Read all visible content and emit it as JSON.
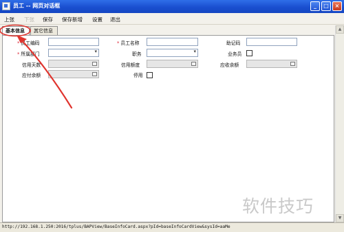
{
  "window": {
    "title": "员工 -- 网页对话框"
  },
  "toolbar": {
    "items": [
      {
        "label": "上张",
        "enabled": true
      },
      {
        "label": "下张",
        "enabled": false
      },
      {
        "label": "保存",
        "enabled": true
      },
      {
        "label": "保存新增",
        "enabled": true
      },
      {
        "label": "设置",
        "enabled": true
      },
      {
        "label": "退出",
        "enabled": true
      }
    ]
  },
  "tabs": [
    {
      "label": "基本信息",
      "active": true
    },
    {
      "label": "其它信息",
      "active": false
    }
  ],
  "form": {
    "employee_code": {
      "label": "员工编码",
      "value": "",
      "required": true
    },
    "employee_name": {
      "label": "员工名称",
      "value": "",
      "required": true
    },
    "mnemonic_code": {
      "label": "助记码",
      "value": ""
    },
    "department": {
      "label": "所属部门",
      "value": "",
      "required": true
    },
    "position": {
      "label": "职务",
      "value": ""
    },
    "salesperson": {
      "label": "业务员",
      "checked": false
    },
    "credit_days": {
      "label": "信用天数",
      "value": ""
    },
    "credit_limit": {
      "label": "信用额度",
      "value": ""
    },
    "receivable_balance": {
      "label": "应收余额",
      "value": ""
    },
    "payable_balance": {
      "label": "应付余额",
      "value": ""
    },
    "disabled": {
      "label": "停用",
      "checked": false
    }
  },
  "status": {
    "url": "http://192.168.1.250:2016/tplus/BAPView/BaseInfoCard.aspx?pId=baseInfoCardView&sysId=aaMe"
  },
  "watermark": "软件技巧",
  "colors": {
    "titlebar": "#1a4fd0",
    "annotation": "#e0342e",
    "required_marker": "#d23333"
  }
}
